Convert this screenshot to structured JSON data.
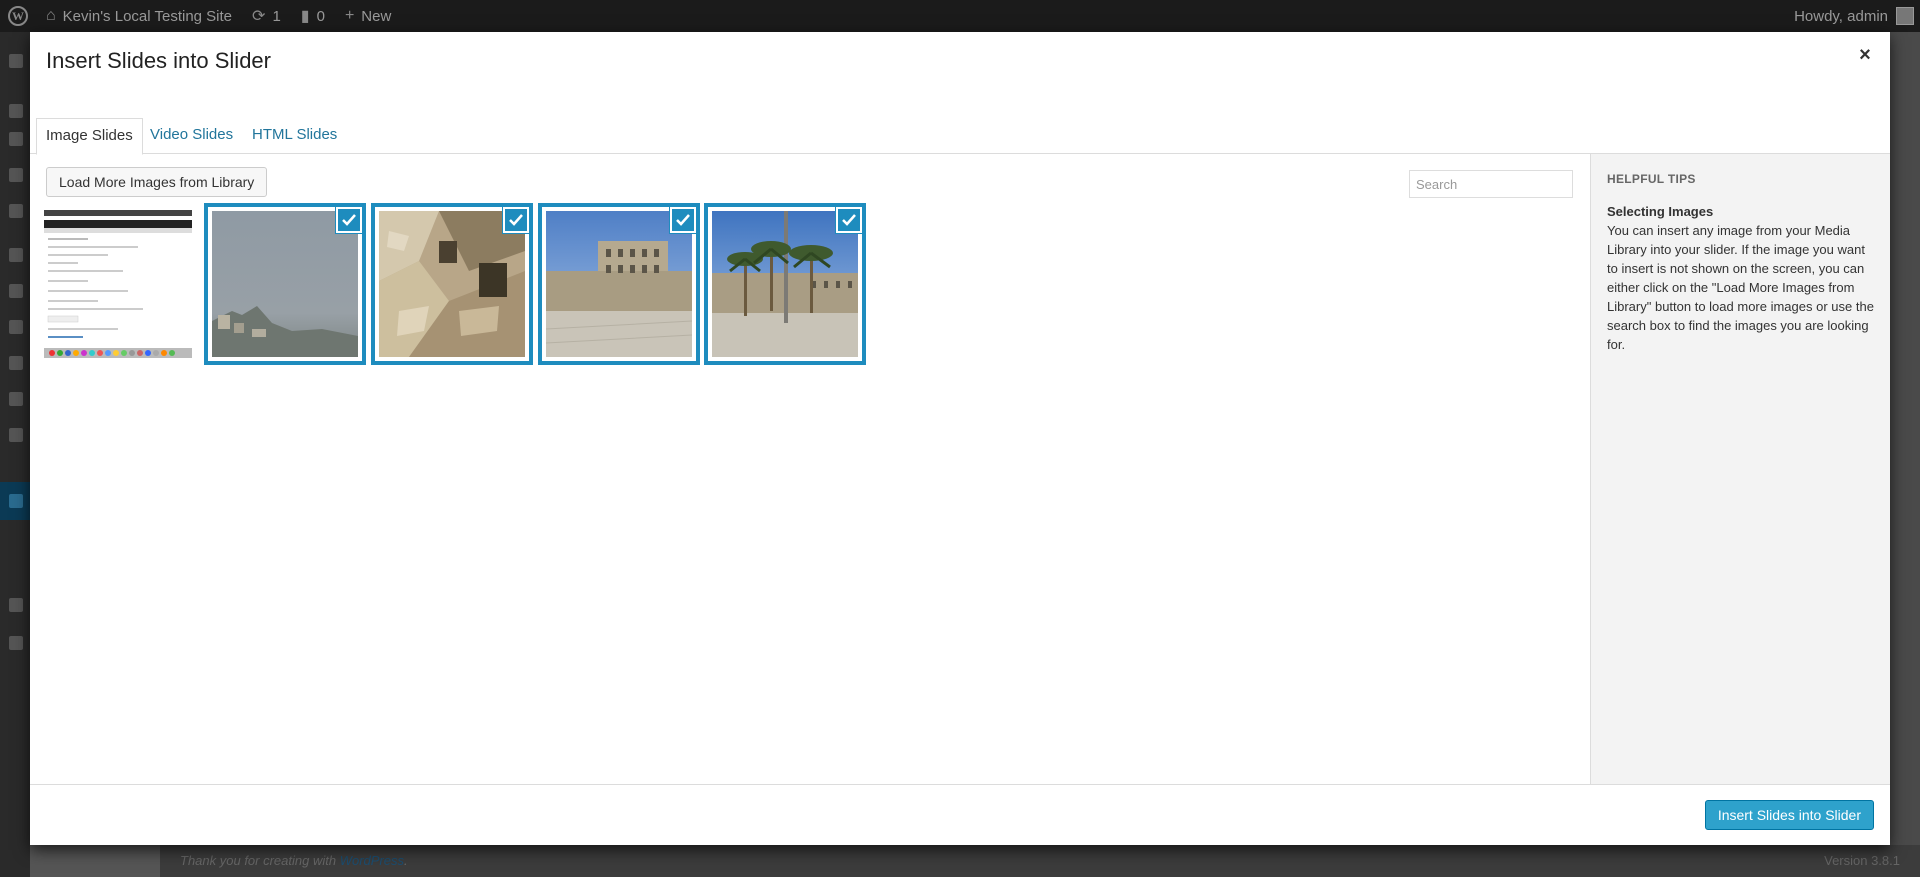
{
  "adminbar": {
    "site_name": "Kevin's Local Testing Site",
    "updates_count": "1",
    "comments_count": "0",
    "new_label": "New",
    "howdy": "Howdy, admin"
  },
  "background": {
    "footer_thanks": "Thank you for creating with",
    "footer_link": "WordPress",
    "footer_period": ".",
    "version": "Version 3.8.1"
  },
  "modal": {
    "title": "Insert Slides into Slider",
    "close_glyph": "×",
    "tabs": [
      {
        "label": "Image Slides",
        "active": true
      },
      {
        "label": "Video Slides",
        "active": false
      },
      {
        "label": "HTML Slides",
        "active": false
      }
    ],
    "load_more_label": "Load More Images from Library",
    "search_placeholder": "Search",
    "images": [
      {
        "name": "screenshot-thumbnail",
        "selected": false
      },
      {
        "name": "hazy-hillside-photo",
        "selected": true
      },
      {
        "name": "stone-ruins-photo",
        "selected": true
      },
      {
        "name": "stone-building-courtyard-photo",
        "selected": true
      },
      {
        "name": "palm-trees-building-photo",
        "selected": true
      }
    ],
    "tips": {
      "heading": "HELPFUL TIPS",
      "subheading": "Selecting Images",
      "body": "You can insert any image from your Media Library into your slider. If the image you want to insert is not shown on the screen, you can either click on the \"Load More Images from Library\" button to load more images or use the search box to find the images you are looking for."
    },
    "insert_label": "Insert Slides into Slider"
  },
  "colors": {
    "accent": "#1e8cbe",
    "primary_button": "#2ea2cc",
    "link": "#21759b"
  }
}
